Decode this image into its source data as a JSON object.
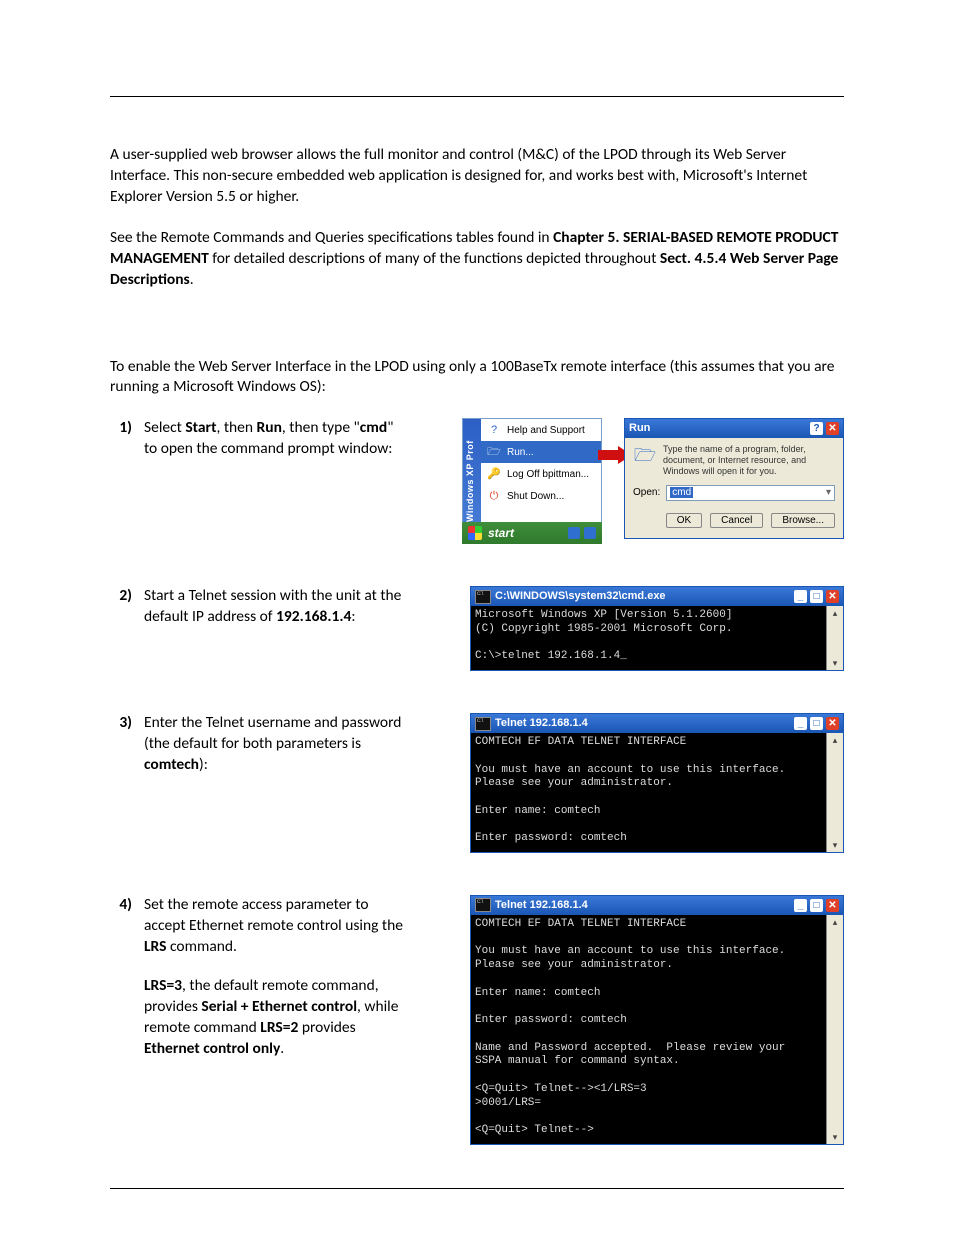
{
  "intro": {
    "p1a": "A user-supplied web browser allows the full monitor and control (M&C) of the LPOD through its Web Server Interface. This non-secure embedded web application is designed for, and works best with, Microsoft's Internet Explorer Version 5.5 or higher.",
    "p2a": "See the Remote Commands and Queries specifications tables found in ",
    "p2b": "Chapter 5. SERIAL-BASED REMOTE PRODUCT MANAGEMENT",
    "p2c": " for detailed descriptions of many of the functions depicted throughout ",
    "p2d": "Sect. 4.5.4 Web Server Page Descriptions",
    "p2e": ".",
    "p3": "To enable the Web Server Interface in the LPOD using only a 100BaseTx remote interface (this assumes that you are running a Microsoft Windows OS):"
  },
  "steps": {
    "s1": {
      "num": "1)",
      "t1": "Select ",
      "t2": "Start",
      "t3": ", then ",
      "t4": "Run",
      "t5": ", then type \"",
      "t6": "cmd",
      "t7": "\" to open the command prompt window:"
    },
    "s2": {
      "num": "2)",
      "t1": "Start a Telnet session with the unit at the default IP address of ",
      "t2": "192.168.1.4",
      "t3": ":"
    },
    "s3": {
      "num": "3)",
      "t1": "Enter the Telnet username and password (the default for both parameters is ",
      "t2": "comtech",
      "t3": "):"
    },
    "s4": {
      "num": "4)",
      "p1a": "Set the remote access parameter to accept Ethernet remote control using the ",
      "p1b": "LRS",
      "p1c": " command.",
      "p2a": "LRS=3",
      "p2b": ", the default remote command, provides ",
      "p2c": "Serial + Ethernet control",
      "p2d": ", while remote command ",
      "p2e": "LRS=2",
      "p2f": " provides ",
      "p2g": "Ethernet control only",
      "p2h": "."
    }
  },
  "startmenu": {
    "stripe": "Windows XP Prof",
    "items": {
      "help": "Help and Support",
      "run": "Run...",
      "logoff": "Log Off bpittman...",
      "shut": "Shut Down..."
    },
    "start_label": "start"
  },
  "rundialog": {
    "title": "Run",
    "desc": "Type the name of a program, folder, document, or Internet resource, and Windows will open it for you.",
    "open_label": "Open:",
    "open_value": "cmd",
    "btn_ok": "OK",
    "btn_cancel": "Cancel",
    "btn_browse": "Browse..."
  },
  "term2": {
    "title": "C:\\WINDOWS\\system32\\cmd.exe",
    "body": "Microsoft Windows XP [Version 5.1.2600]\n(C) Copyright 1985-2001 Microsoft Corp.\n\nC:\\>telnet 192.168.1.4_"
  },
  "term3": {
    "title": "Telnet 192.168.1.4",
    "body": "COMTECH EF DATA TELNET INTERFACE\n\nYou must have an account to use this interface.\nPlease see your administrator.\n\nEnter name: comtech\n\nEnter password: comtech\n"
  },
  "term4": {
    "title": "Telnet 192.168.1.4",
    "body": "COMTECH EF DATA TELNET INTERFACE\n\nYou must have an account to use this interface.\nPlease see your administrator.\n\nEnter name: comtech\n\nEnter password: comtech\n\nName and Password accepted.  Please review your\nSSPA manual for command syntax.\n\n<Q=Quit> Telnet--><1/LRS=3\n>0001/LRS=\n\n<Q=Quit> Telnet-->"
  }
}
